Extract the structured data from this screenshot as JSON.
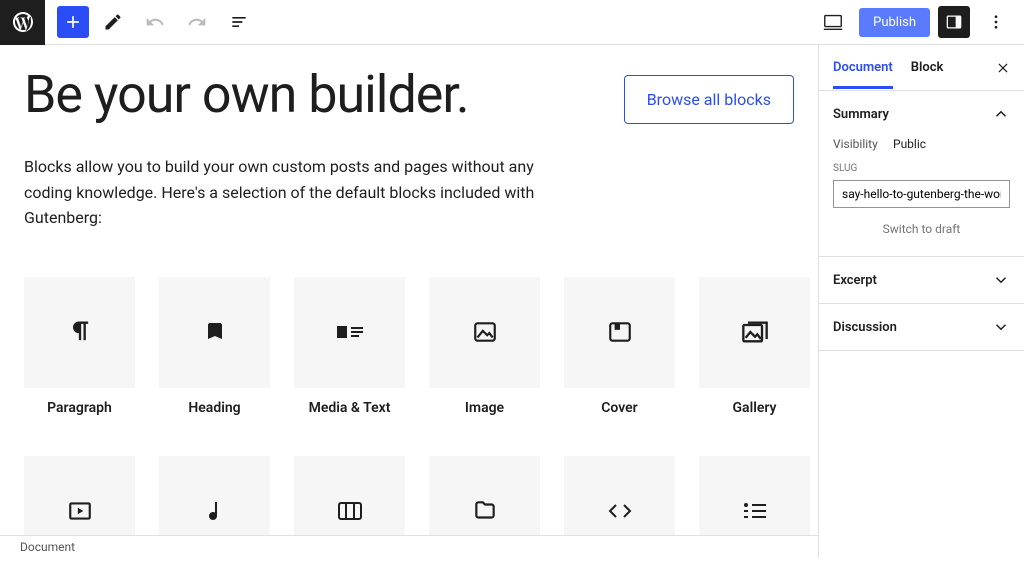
{
  "topbar": {
    "publish_label": "Publish"
  },
  "hero": {
    "title": "Be your own builder.",
    "browse_label": "Browse all blocks"
  },
  "description": "Blocks allow you to build your own custom posts and pages without any coding knowledge. Here's a selection of the default blocks included with Gutenberg:",
  "blocks": {
    "row1": [
      "Paragraph",
      "Heading",
      "Media & Text",
      "Image",
      "Cover",
      "Gallery"
    ]
  },
  "sidebar": {
    "tabs": {
      "document": "Document",
      "block": "Block"
    },
    "summary": {
      "title": "Summary",
      "visibility_label": "Visibility",
      "visibility_value": "Public",
      "slug_label": "SLUG",
      "slug_value": "say-hello-to-gutenberg-the-wordpress-ed",
      "switch_draft": "Switch to draft"
    },
    "excerpt": "Excerpt",
    "discussion": "Discussion"
  },
  "breadcrumb": "Document"
}
